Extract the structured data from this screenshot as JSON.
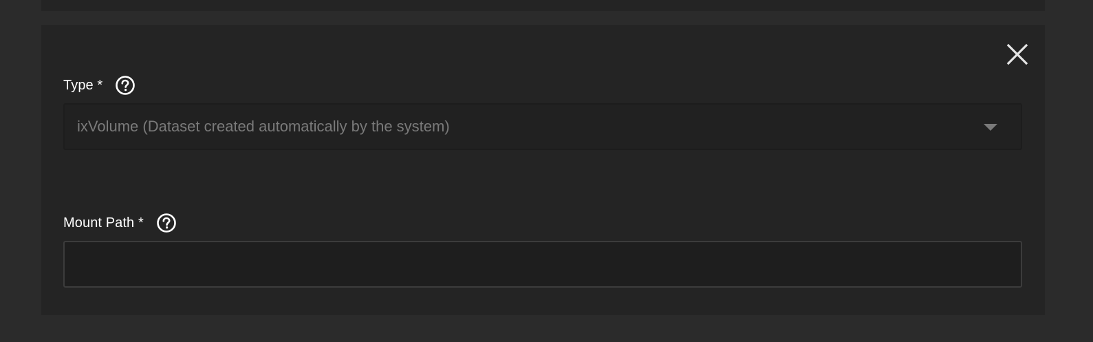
{
  "form": {
    "close_icon": "close-icon",
    "type_field": {
      "label": "Type *",
      "help_icon": "help-circle-icon",
      "selected_value": "ixVolume (Dataset created automatically by the system)"
    },
    "mount_path_field": {
      "label": "Mount Path *",
      "help_icon": "help-circle-icon",
      "value": "",
      "placeholder": ""
    }
  },
  "colors": {
    "page_background": "#2b2b2b",
    "card_background": "#242424",
    "label_text": "#ffffff",
    "disabled_value_text": "#7a7a7a"
  }
}
